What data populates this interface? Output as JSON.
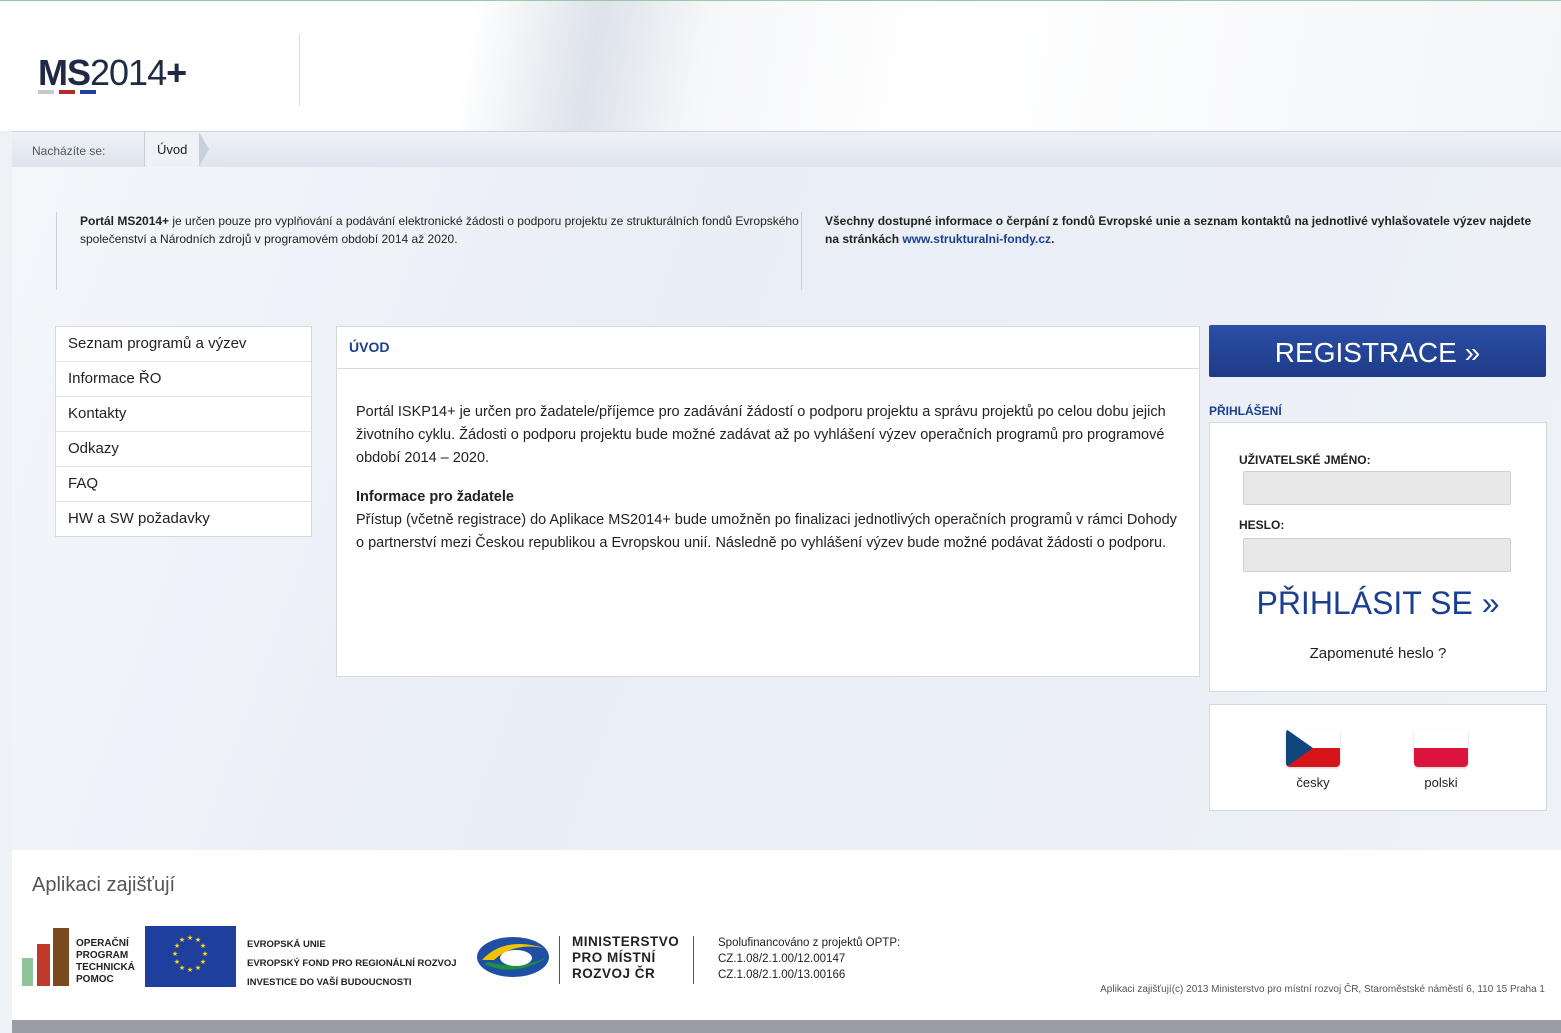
{
  "header": {
    "logo_bold": "MS",
    "logo_rest": "2014",
    "logo_plus": "+"
  },
  "breadcrumb": {
    "label": "Nacházíte se:",
    "current": "Úvod"
  },
  "info": {
    "left_bold": "Portál MS2014+",
    "left_text": " je určen pouze pro vyplňování a podávání elektronické žádosti o podporu projektu ze strukturálních fondů Evropského společenství a Národních zdrojů v programovém období 2014 až 2020.",
    "right_text": "Všechny dostupné informace o čerpání z fondů Evropské unie a seznam kontaktů na jednotlivé vyhlašovatele výzev najdete na stránkách ",
    "right_link": "www.strukturalni-fondy.cz",
    "right_end": "."
  },
  "sidebar": {
    "items": [
      {
        "label": "Seznam programů a výzev"
      },
      {
        "label": "Informace ŘO"
      },
      {
        "label": "Kontakty"
      },
      {
        "label": "Odkazy"
      },
      {
        "label": "FAQ"
      },
      {
        "label": "HW a SW požadavky"
      }
    ]
  },
  "content": {
    "title": "ÚVOD",
    "para1": "Portál ISKP14+ je určen pro žadatele/příjemce pro zadávání žádostí o podporu projektu a správu projektů po celou dobu jejich životního cyklu. Žádosti o podporu projektu bude možné zadávat až po vyhlášení výzev operačních programů pro programové období 2014 – 2020.",
    "heading2": "Informace pro žadatele",
    "para2": "Přístup (včetně registrace) do Aplikace MS2014+ bude umožněn po finalizaci jednotlivých operačních programů v rámci Dohody o partnerství mezi Českou republikou a Evropskou unií. Následně po vyhlášení výzev bude možné podávat žádosti o podporu."
  },
  "login": {
    "register_label": "REGISTRACE »",
    "section_label": "PŘIHLÁŠENÍ",
    "username_label": "UŽIVATELSKÉ JMÉNO:",
    "password_label": "HESLO:",
    "username_value": "",
    "password_value": "",
    "submit_label": "PŘIHLÁSIT SE »",
    "forgot_label": "Zapomenuté heslo ?"
  },
  "languages": [
    {
      "label": "česky"
    },
    {
      "label": "polski"
    }
  ],
  "footer": {
    "title": "Aplikaci zajišťují",
    "optp_lines": [
      "OPERAČNÍ",
      "PROGRAM",
      "TECHNICKÁ",
      "POMOC"
    ],
    "eu_lines": [
      "EVROPSKÁ UNIE",
      "EVROPSKÝ FOND PRO REGIONÁLNÍ ROZVOJ",
      "INVESTICE DO VAŠÍ BUDOUCNOSTI"
    ],
    "mmr_lines": [
      "MINISTERSTVO",
      "PRO MÍSTNÍ",
      "ROZVOJ ČR"
    ],
    "project_lines": [
      "Spolufinancováno z projektů OPTP:",
      "CZ.1.08/2.1.00/12.00147",
      "CZ.1.08/2.1.00/13.00166"
    ],
    "copyright": "Aplikaci zajišťují(c) 2013 Ministerstvo pro místní rozvoj ČR, Staroměstské náměstí 6, 110 15 Praha 1"
  },
  "colors": {
    "brand_blue": "#1b3f8f",
    "register_bg": "#1d3b87",
    "logo_bar_gray": "#c9c9c9",
    "logo_bar_red": "#b32d2e",
    "logo_bar_blue": "#1f3f9e"
  }
}
